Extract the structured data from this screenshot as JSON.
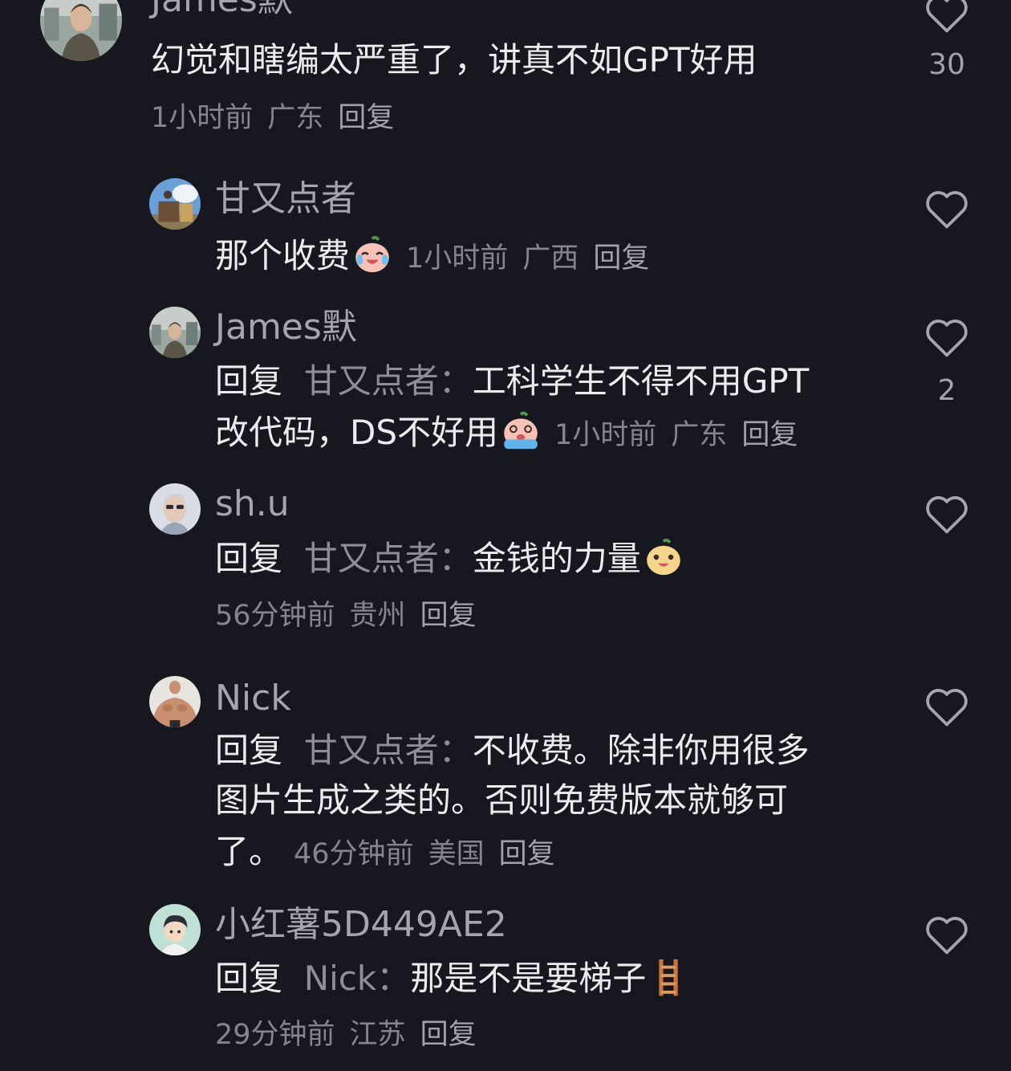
{
  "comments": [
    {
      "name": "James默",
      "text": "幻觉和瞎编太严重了，讲真不如GPT好用",
      "time": "1小时前",
      "location": "广东",
      "reply_label": "回复",
      "like_count": "30",
      "avatar_icon": "man-portrait-avatar"
    },
    {
      "name": "甘又点者",
      "text": "那个收费",
      "emoji": "crying-laughing-emoji",
      "time": "1小时前",
      "location": "广西",
      "reply_label": "回复",
      "avatar_icon": "bird-on-tree-avatar"
    },
    {
      "name": "James默",
      "reply_prefix": "回复",
      "reply_to": "甘又点者：",
      "text_line1": "工科学生不得不用GPT",
      "text_line2": "改代码，DS不好用",
      "emoji": "crying-emoji",
      "time": "1小时前",
      "location": "广东",
      "reply_label": "回复",
      "like_count": "2",
      "avatar_icon": "man-portrait-avatar"
    },
    {
      "name": "sh.u",
      "reply_prefix": "回复",
      "reply_to": "甘又点者：",
      "text": "金钱的力量",
      "emoji": "grinning-emoji",
      "time": "56分钟前",
      "location": "贵州",
      "reply_label": "回复",
      "avatar_icon": "sunglasses-person-avatar"
    },
    {
      "name": "Nick",
      "reply_prefix": "回复",
      "reply_to": "甘又点者：",
      "text_line1": "不收费。除非你用很多",
      "text_line2": "图片生成之类的。否则免费版本就够可",
      "text_line3": "了。",
      "time": "46分钟前",
      "location": "美国",
      "reply_label": "回复",
      "avatar_icon": "muscle-man-avatar"
    },
    {
      "name": "小红薯5D449AE2",
      "reply_prefix": "回复",
      "reply_to": "Nick：",
      "text": "那是不是要梯子",
      "emoji": "ladder-emoji",
      "time": "29分钟前",
      "location": "江苏",
      "reply_label": "回复",
      "avatar_icon": "cartoon-boy-avatar"
    }
  ],
  "colors": {
    "background": "#17171f",
    "text": "#ececef",
    "muted": "#85858d",
    "name": "#a5a5ad"
  }
}
